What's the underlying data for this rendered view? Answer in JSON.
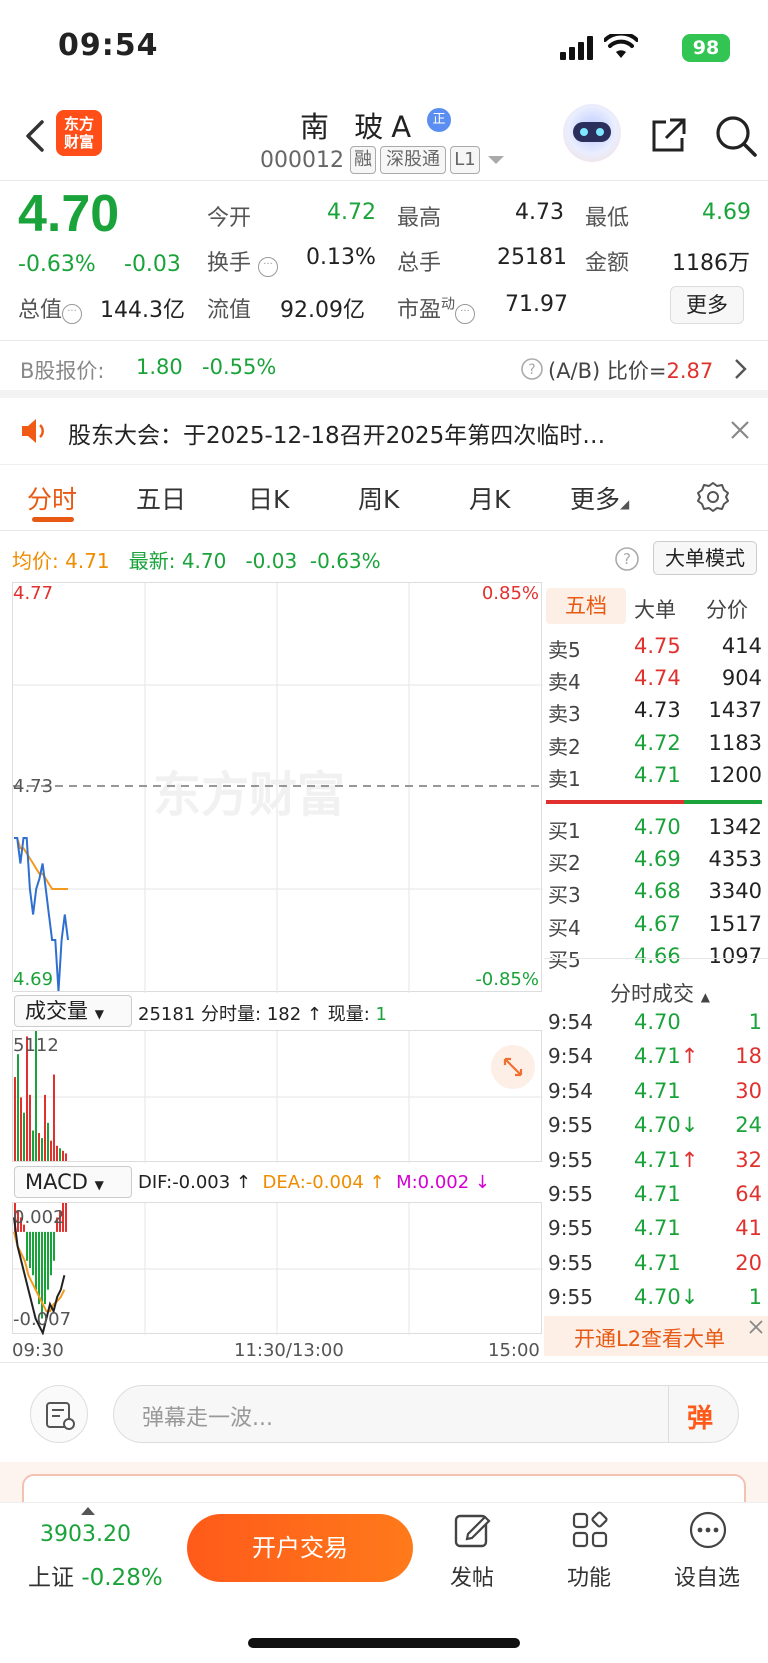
{
  "status": {
    "time": "09:54",
    "battery": "98"
  },
  "header": {
    "logo": "东方\n财富",
    "name": "南 玻A",
    "zheng_badge": "正",
    "code": "000012",
    "tags": [
      "融",
      "深股通",
      "L1"
    ]
  },
  "quote": {
    "price": "4.70",
    "change_pct": "-0.63%",
    "change": "-0.03",
    "rows": [
      [
        {
          "label": "今开",
          "value": "4.72",
          "color": "green"
        },
        {
          "label": "最高",
          "value": "4.73",
          "color": "black"
        },
        {
          "label": "最低",
          "value": "4.69",
          "color": "green"
        }
      ],
      [
        {
          "label": "换手",
          "value": "0.13%",
          "color": "black"
        },
        {
          "label": "总手",
          "value": "25181",
          "color": "black"
        },
        {
          "label": "金额",
          "value": "1186万",
          "color": "black"
        }
      ],
      [
        {
          "label": "总值",
          "value": "144.3亿",
          "color": "black"
        },
        {
          "label": "流值",
          "value": "92.09亿",
          "color": "black"
        },
        {
          "label": "市盈",
          "value": "71.97",
          "color": "black"
        }
      ]
    ],
    "pe_superscript": "动",
    "more_label": "更多"
  },
  "bshare": {
    "label": "B股报价:",
    "price": "1.80",
    "pct": "-0.55%",
    "ratio_label": "(A/B) 比价=",
    "ratio": "2.87"
  },
  "notice": {
    "text": "股东大会：于2025-12-18召开2025年第四次临时…"
  },
  "tabs": [
    "分时",
    "五日",
    "日K",
    "周K",
    "月K",
    "更多"
  ],
  "info": {
    "avg_label": "均价:",
    "avg": "4.71",
    "latest_label": "最新:",
    "latest": "4.70",
    "chg": "-0.03",
    "pct": "-0.63%",
    "big_mode": "大单模式"
  },
  "intraday": {
    "y_top": "4.77",
    "y_mid": "4.73",
    "y_bot": "4.69",
    "pct_top": "0.85%",
    "pct_bot": "-0.85%",
    "watermark": "东方财富",
    "x_labels": [
      "09:30",
      "11:30/13:00",
      "15:00"
    ]
  },
  "volume": {
    "selector": "成交量",
    "total": "25181",
    "minute_label": "分时量:",
    "minute": "182 ↑",
    "now_label": "现量:",
    "now": "1",
    "ymax": "5112"
  },
  "macd": {
    "selector": "MACD",
    "dif": "DIF:-0.003 ↑",
    "dea": "DEA:-0.004 ↑",
    "m": "M:0.002 ↓",
    "ymax": "0.002",
    "ymin": "-0.007"
  },
  "orderbook": {
    "tabs": [
      "五档",
      "大单",
      "分价"
    ],
    "sells": [
      [
        "卖5",
        "4.75",
        "414",
        "red"
      ],
      [
        "卖4",
        "4.74",
        "904",
        "red"
      ],
      [
        "卖3",
        "4.73",
        "1437",
        "black"
      ],
      [
        "卖2",
        "4.72",
        "1183",
        "green"
      ],
      [
        "卖1",
        "4.71",
        "1200",
        "green"
      ]
    ],
    "buys": [
      [
        "买1",
        "4.70",
        "1342",
        "green"
      ],
      [
        "买2",
        "4.69",
        "4353",
        "green"
      ],
      [
        "买3",
        "4.68",
        "3340",
        "green"
      ],
      [
        "买4",
        "4.67",
        "1517",
        "green"
      ],
      [
        "买5",
        "4.66",
        "1097",
        "green"
      ]
    ]
  },
  "ticks": {
    "title": "分时成交",
    "rows": [
      [
        "9:54",
        "4.70",
        "",
        "1",
        "green"
      ],
      [
        "9:54",
        "4.71",
        "↑",
        "18",
        "red"
      ],
      [
        "9:54",
        "4.71",
        "",
        "30",
        "red"
      ],
      [
        "9:55",
        "4.70",
        "↓",
        "24",
        "green"
      ],
      [
        "9:55",
        "4.71",
        "↑",
        "32",
        "red"
      ],
      [
        "9:55",
        "4.71",
        "",
        "64",
        "red"
      ],
      [
        "9:55",
        "4.71",
        "",
        "41",
        "red"
      ],
      [
        "9:55",
        "4.71",
        "",
        "20",
        "red"
      ],
      [
        "9:55",
        "4.70",
        "↓",
        "1",
        "green"
      ]
    ],
    "l2_banner": "开通L2查看大单"
  },
  "danmu": {
    "placeholder": "弹幕走一波...",
    "send": "弹"
  },
  "bottom": {
    "index": "3903.20",
    "index_name": "上证",
    "index_pct": "-0.28%",
    "open": "开户交易",
    "post": "发帖",
    "func": "功能",
    "watch": "设自选"
  },
  "colors": {
    "up": "#e0312f",
    "down": "#1aa33a",
    "accent": "#e85a14"
  },
  "chart_data": {
    "type": "line",
    "price_series": {
      "name": "",
      "values": [
        4.72,
        4.72,
        4.715,
        4.72,
        4.72,
        4.71,
        4.705,
        4.71,
        4.712,
        4.715,
        4.71,
        4.705,
        4.7,
        4.7,
        4.69,
        4.7,
        4.705,
        4.7
      ]
    },
    "avg_series": {
      "name": "均价",
      "values": [
        4.72,
        4.72,
        4.718,
        4.718,
        4.717,
        4.716,
        4.715,
        4.714,
        4.713,
        4.713,
        4.712,
        4.711,
        4.71,
        4.71,
        4.71,
        4.71,
        4.71,
        4.71
      ]
    },
    "ylim": [
      4.69,
      4.77
    ],
    "volume": [
      3300,
      4200,
      2500,
      1900,
      4900,
      2600,
      1200,
      5112,
      1100,
      900,
      2600,
      1500,
      800,
      3400,
      600,
      500,
      400,
      300
    ],
    "volume_colors": [
      "red",
      "green",
      "red",
      "green",
      "red",
      "red",
      "green",
      "green",
      "red",
      "green",
      "red",
      "green",
      "red",
      "red",
      "red",
      "green",
      "red",
      "red"
    ],
    "macd_hist": [
      0.002,
      0.0015,
      0.001,
      0.0005,
      -0.002,
      -0.0025,
      -0.003,
      -0.004,
      -0.005,
      -0.006,
      -0.005,
      -0.004,
      -0.003,
      -0.002,
      0.001,
      0.0015,
      0.002,
      0.002
    ],
    "macd_ylim": [
      -0.007,
      0.002
    ]
  }
}
